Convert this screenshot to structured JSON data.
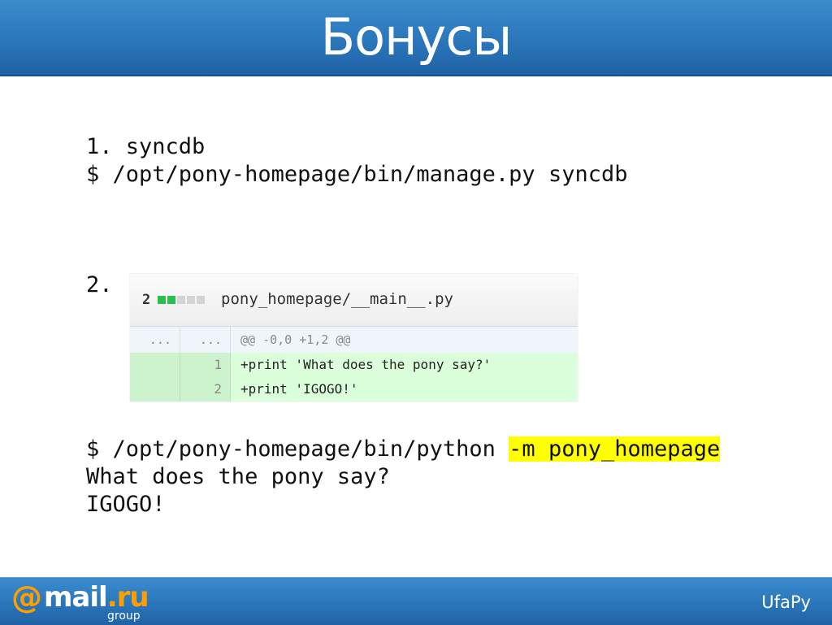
{
  "header": {
    "title": "Бонусы"
  },
  "step1": {
    "label": "1. syncdb",
    "command": "$ /opt/pony-homepage/bin/manage.py syncdb"
  },
  "step2": {
    "label": "2."
  },
  "diff": {
    "count": "2",
    "stat_blocks": [
      "add",
      "add",
      "neutral",
      "neutral",
      "neutral"
    ],
    "filename": "pony_homepage/__main__.py",
    "hunk": {
      "left": "...",
      "right": "...",
      "text": "@@ -0,0 +1,2 @@"
    },
    "lines": [
      {
        "left": "",
        "right": "1",
        "text": "+print 'What does the pony say?'"
      },
      {
        "left": "",
        "right": "2",
        "text": "+print 'IGOGO!'"
      }
    ]
  },
  "run": {
    "command_prefix": "$ /opt/pony-homepage/bin/python ",
    "command_highlight": "-m pony_homepage",
    "highlight_color": "#ffff00",
    "output": [
      "What does the pony say?",
      "IGOGO!"
    ]
  },
  "footer": {
    "logo_at": "@",
    "logo_main": "mail",
    "logo_tld": ".ru",
    "logo_sub": "group",
    "brand": "UfaPy"
  },
  "colors": {
    "header_blue": "#2b76bb",
    "logo_orange": "#ff9e00",
    "diff_added_bg": "#dbffdb"
  }
}
